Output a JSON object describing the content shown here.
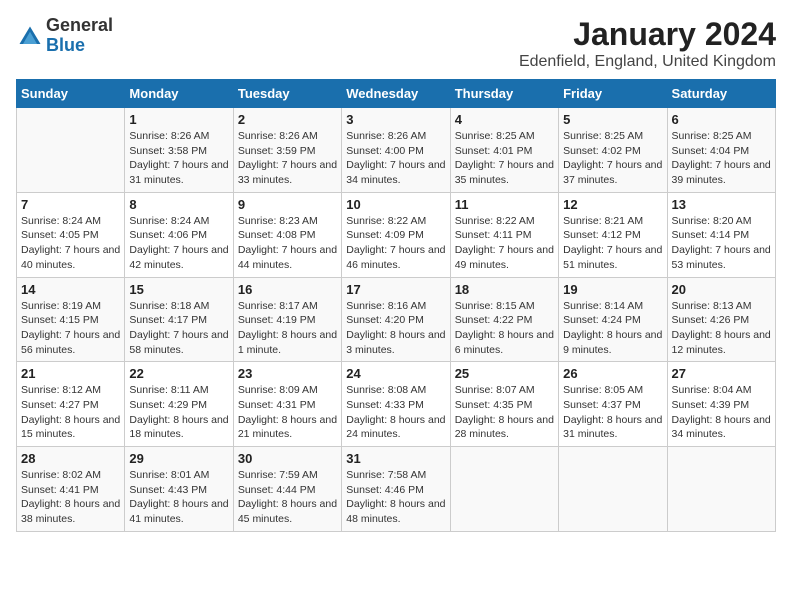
{
  "logo": {
    "general": "General",
    "blue": "Blue"
  },
  "title": "January 2024",
  "subtitle": "Edenfield, England, United Kingdom",
  "calendar": {
    "headers": [
      "Sunday",
      "Monday",
      "Tuesday",
      "Wednesday",
      "Thursday",
      "Friday",
      "Saturday"
    ],
    "weeks": [
      [
        {
          "day": "",
          "sunrise": "",
          "sunset": "",
          "daylight": ""
        },
        {
          "day": "1",
          "sunrise": "Sunrise: 8:26 AM",
          "sunset": "Sunset: 3:58 PM",
          "daylight": "Daylight: 7 hours and 31 minutes."
        },
        {
          "day": "2",
          "sunrise": "Sunrise: 8:26 AM",
          "sunset": "Sunset: 3:59 PM",
          "daylight": "Daylight: 7 hours and 33 minutes."
        },
        {
          "day": "3",
          "sunrise": "Sunrise: 8:26 AM",
          "sunset": "Sunset: 4:00 PM",
          "daylight": "Daylight: 7 hours and 34 minutes."
        },
        {
          "day": "4",
          "sunrise": "Sunrise: 8:25 AM",
          "sunset": "Sunset: 4:01 PM",
          "daylight": "Daylight: 7 hours and 35 minutes."
        },
        {
          "day": "5",
          "sunrise": "Sunrise: 8:25 AM",
          "sunset": "Sunset: 4:02 PM",
          "daylight": "Daylight: 7 hours and 37 minutes."
        },
        {
          "day": "6",
          "sunrise": "Sunrise: 8:25 AM",
          "sunset": "Sunset: 4:04 PM",
          "daylight": "Daylight: 7 hours and 39 minutes."
        }
      ],
      [
        {
          "day": "7",
          "sunrise": "Sunrise: 8:24 AM",
          "sunset": "Sunset: 4:05 PM",
          "daylight": "Daylight: 7 hours and 40 minutes."
        },
        {
          "day": "8",
          "sunrise": "Sunrise: 8:24 AM",
          "sunset": "Sunset: 4:06 PM",
          "daylight": "Daylight: 7 hours and 42 minutes."
        },
        {
          "day": "9",
          "sunrise": "Sunrise: 8:23 AM",
          "sunset": "Sunset: 4:08 PM",
          "daylight": "Daylight: 7 hours and 44 minutes."
        },
        {
          "day": "10",
          "sunrise": "Sunrise: 8:22 AM",
          "sunset": "Sunset: 4:09 PM",
          "daylight": "Daylight: 7 hours and 46 minutes."
        },
        {
          "day": "11",
          "sunrise": "Sunrise: 8:22 AM",
          "sunset": "Sunset: 4:11 PM",
          "daylight": "Daylight: 7 hours and 49 minutes."
        },
        {
          "day": "12",
          "sunrise": "Sunrise: 8:21 AM",
          "sunset": "Sunset: 4:12 PM",
          "daylight": "Daylight: 7 hours and 51 minutes."
        },
        {
          "day": "13",
          "sunrise": "Sunrise: 8:20 AM",
          "sunset": "Sunset: 4:14 PM",
          "daylight": "Daylight: 7 hours and 53 minutes."
        }
      ],
      [
        {
          "day": "14",
          "sunrise": "Sunrise: 8:19 AM",
          "sunset": "Sunset: 4:15 PM",
          "daylight": "Daylight: 7 hours and 56 minutes."
        },
        {
          "day": "15",
          "sunrise": "Sunrise: 8:18 AM",
          "sunset": "Sunset: 4:17 PM",
          "daylight": "Daylight: 7 hours and 58 minutes."
        },
        {
          "day": "16",
          "sunrise": "Sunrise: 8:17 AM",
          "sunset": "Sunset: 4:19 PM",
          "daylight": "Daylight: 8 hours and 1 minute."
        },
        {
          "day": "17",
          "sunrise": "Sunrise: 8:16 AM",
          "sunset": "Sunset: 4:20 PM",
          "daylight": "Daylight: 8 hours and 3 minutes."
        },
        {
          "day": "18",
          "sunrise": "Sunrise: 8:15 AM",
          "sunset": "Sunset: 4:22 PM",
          "daylight": "Daylight: 8 hours and 6 minutes."
        },
        {
          "day": "19",
          "sunrise": "Sunrise: 8:14 AM",
          "sunset": "Sunset: 4:24 PM",
          "daylight": "Daylight: 8 hours and 9 minutes."
        },
        {
          "day": "20",
          "sunrise": "Sunrise: 8:13 AM",
          "sunset": "Sunset: 4:26 PM",
          "daylight": "Daylight: 8 hours and 12 minutes."
        }
      ],
      [
        {
          "day": "21",
          "sunrise": "Sunrise: 8:12 AM",
          "sunset": "Sunset: 4:27 PM",
          "daylight": "Daylight: 8 hours and 15 minutes."
        },
        {
          "day": "22",
          "sunrise": "Sunrise: 8:11 AM",
          "sunset": "Sunset: 4:29 PM",
          "daylight": "Daylight: 8 hours and 18 minutes."
        },
        {
          "day": "23",
          "sunrise": "Sunrise: 8:09 AM",
          "sunset": "Sunset: 4:31 PM",
          "daylight": "Daylight: 8 hours and 21 minutes."
        },
        {
          "day": "24",
          "sunrise": "Sunrise: 8:08 AM",
          "sunset": "Sunset: 4:33 PM",
          "daylight": "Daylight: 8 hours and 24 minutes."
        },
        {
          "day": "25",
          "sunrise": "Sunrise: 8:07 AM",
          "sunset": "Sunset: 4:35 PM",
          "daylight": "Daylight: 8 hours and 28 minutes."
        },
        {
          "day": "26",
          "sunrise": "Sunrise: 8:05 AM",
          "sunset": "Sunset: 4:37 PM",
          "daylight": "Daylight: 8 hours and 31 minutes."
        },
        {
          "day": "27",
          "sunrise": "Sunrise: 8:04 AM",
          "sunset": "Sunset: 4:39 PM",
          "daylight": "Daylight: 8 hours and 34 minutes."
        }
      ],
      [
        {
          "day": "28",
          "sunrise": "Sunrise: 8:02 AM",
          "sunset": "Sunset: 4:41 PM",
          "daylight": "Daylight: 8 hours and 38 minutes."
        },
        {
          "day": "29",
          "sunrise": "Sunrise: 8:01 AM",
          "sunset": "Sunset: 4:43 PM",
          "daylight": "Daylight: 8 hours and 41 minutes."
        },
        {
          "day": "30",
          "sunrise": "Sunrise: 7:59 AM",
          "sunset": "Sunset: 4:44 PM",
          "daylight": "Daylight: 8 hours and 45 minutes."
        },
        {
          "day": "31",
          "sunrise": "Sunrise: 7:58 AM",
          "sunset": "Sunset: 4:46 PM",
          "daylight": "Daylight: 8 hours and 48 minutes."
        },
        {
          "day": "",
          "sunrise": "",
          "sunset": "",
          "daylight": ""
        },
        {
          "day": "",
          "sunrise": "",
          "sunset": "",
          "daylight": ""
        },
        {
          "day": "",
          "sunrise": "",
          "sunset": "",
          "daylight": ""
        }
      ]
    ]
  }
}
